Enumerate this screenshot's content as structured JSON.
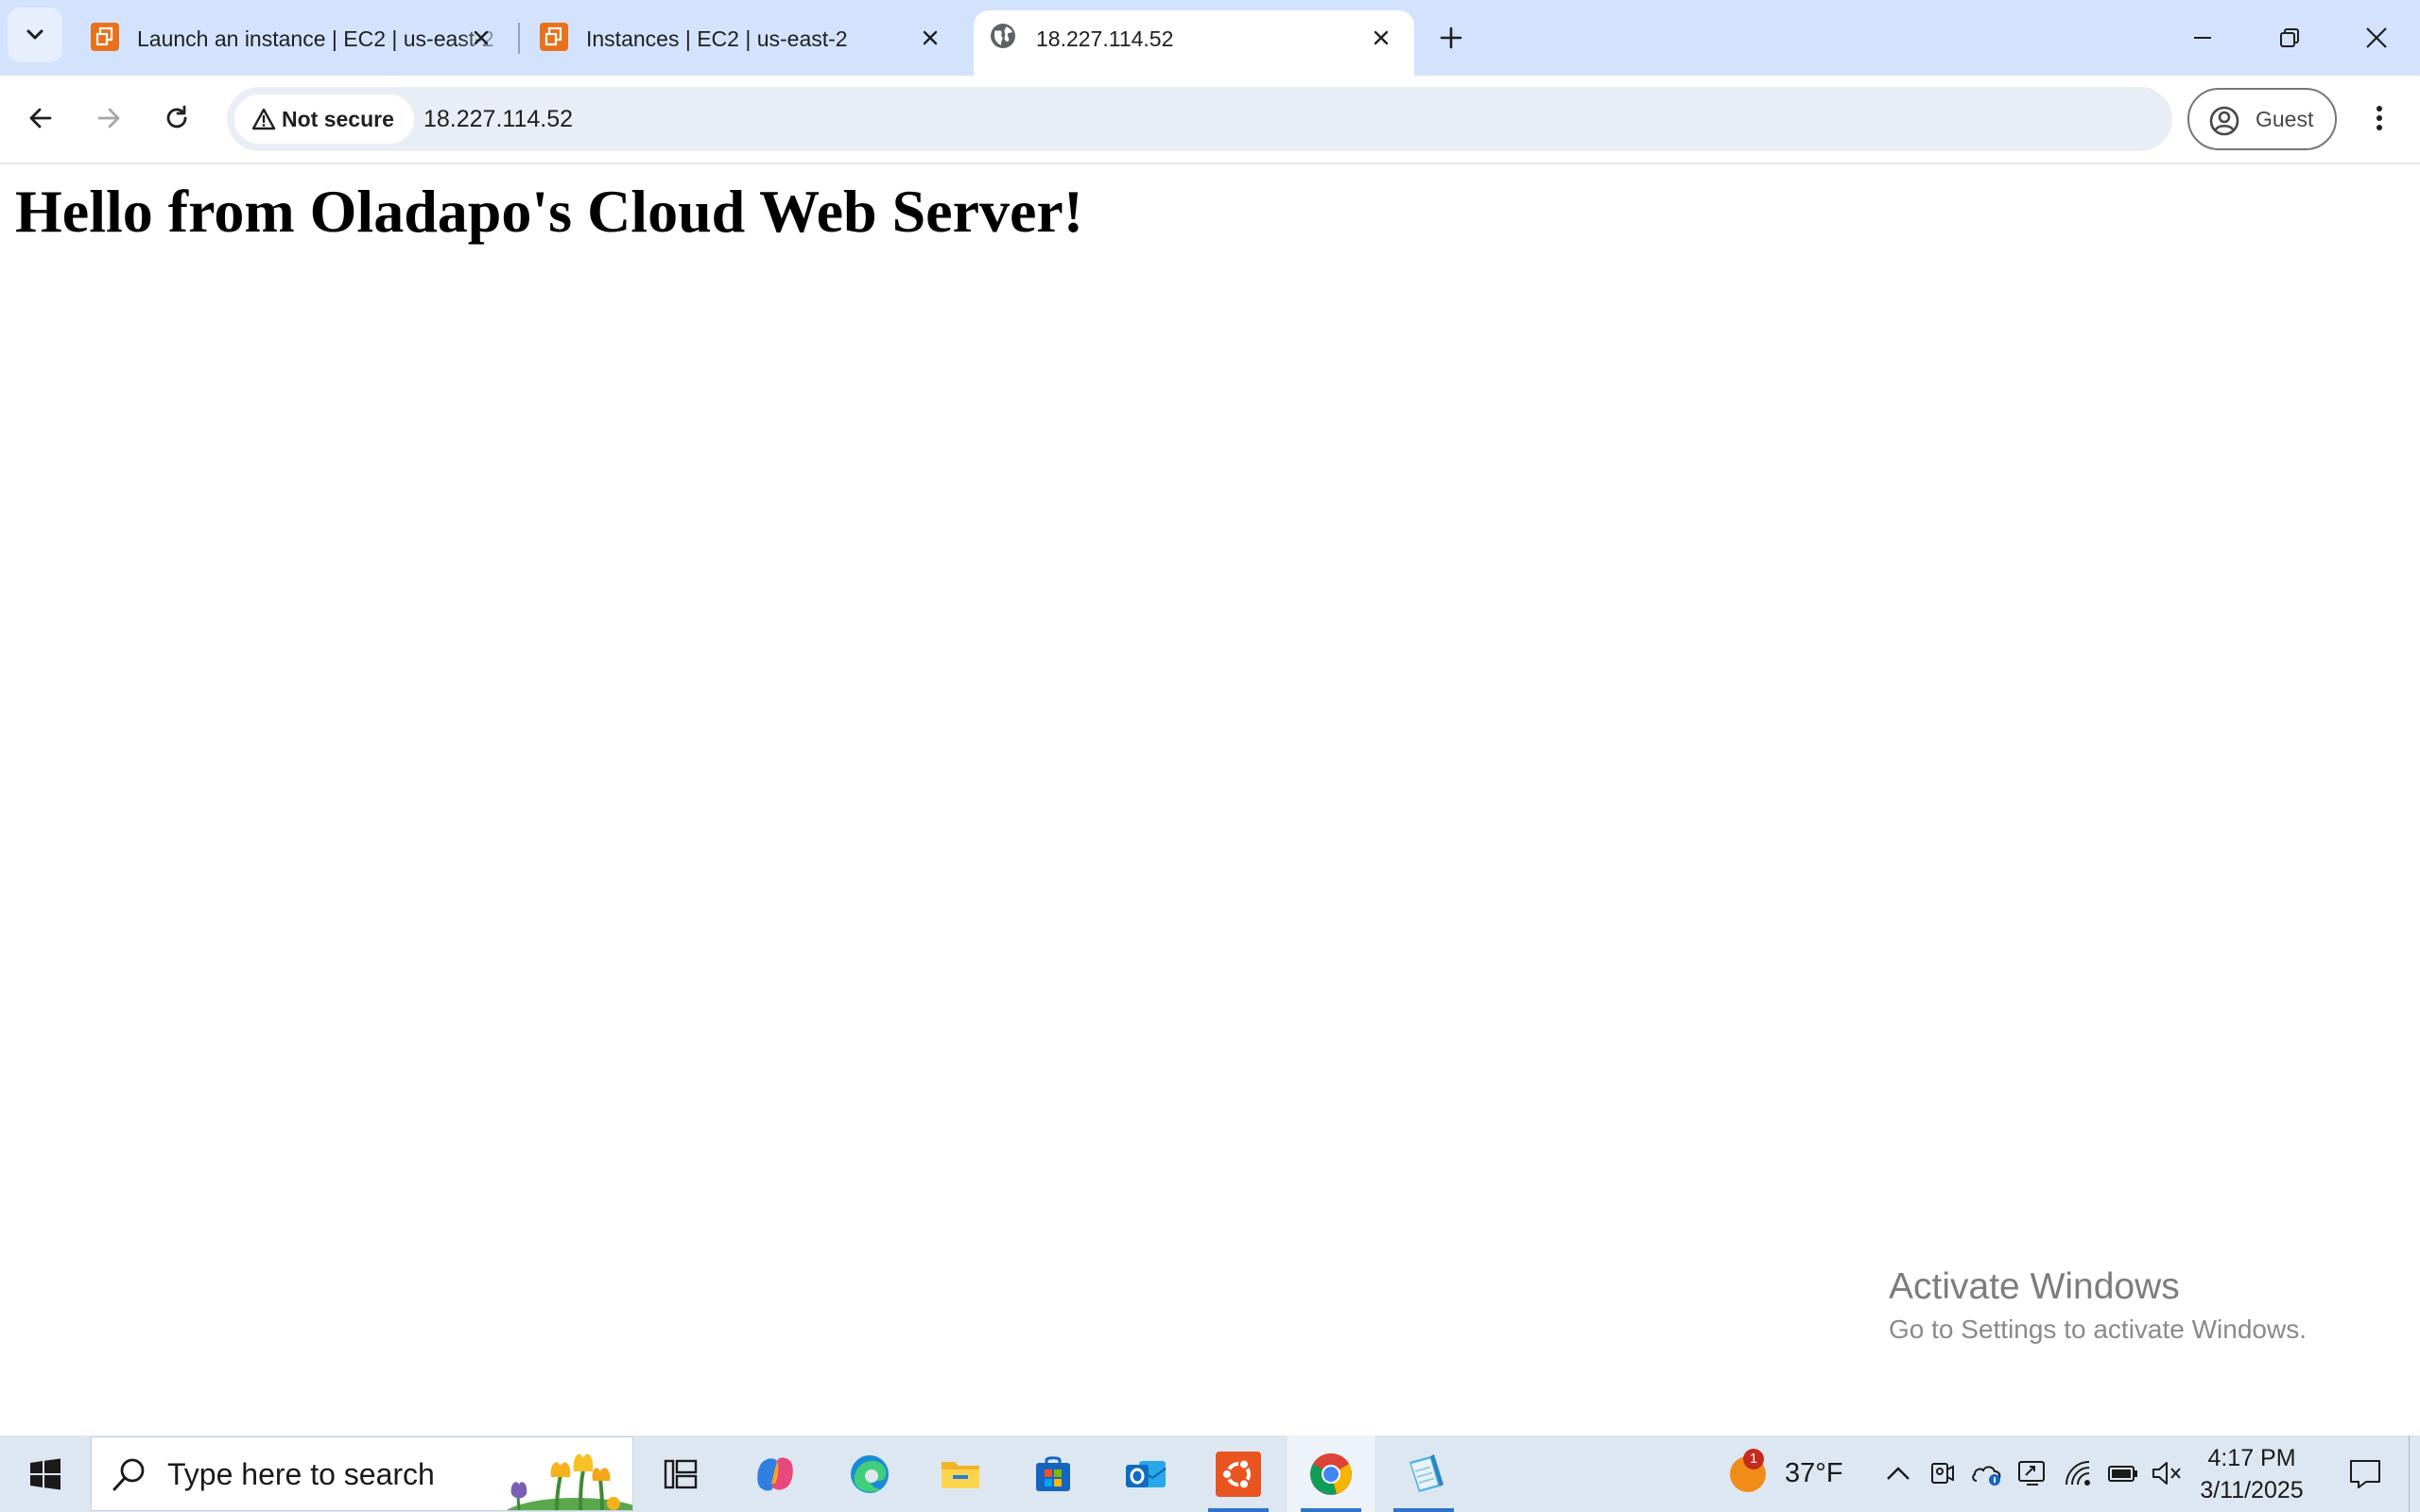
{
  "browser": {
    "tabs": [
      {
        "title": "Launch an instance | EC2 | us-east-2",
        "favicon": "aws-ec2-icon",
        "active": false
      },
      {
        "title": "Instances | EC2 | us-east-2",
        "favicon": "aws-ec2-icon",
        "active": false
      },
      {
        "title": "18.227.114.52",
        "favicon": "globe-icon",
        "active": true
      }
    ],
    "security_label": "Not secure",
    "url": "18.227.114.52",
    "profile_label": "Guest"
  },
  "page": {
    "heading": "Hello from Oladapo's Cloud Web Server!"
  },
  "watermark": {
    "title": "Activate Windows",
    "subtitle": "Go to Settings to activate Windows."
  },
  "taskbar": {
    "search_placeholder": "Type here to search",
    "apps": [
      "task-view",
      "copilot",
      "edge",
      "file-explorer",
      "microsoft-store",
      "outlook",
      "ubuntu",
      "chrome",
      "notepad"
    ],
    "weather": {
      "temperature": "37°F",
      "badge": "1"
    },
    "clock": {
      "time": "4:17 PM",
      "date": "3/11/2025"
    }
  },
  "colors": {
    "tabstrip_bg": "#d3e3fd",
    "omnibox_bg": "#e9eef6",
    "taskbar_bg": "#dde7f2",
    "aws_orange": "#e8711c",
    "running_indicator": "#2e74c8"
  }
}
